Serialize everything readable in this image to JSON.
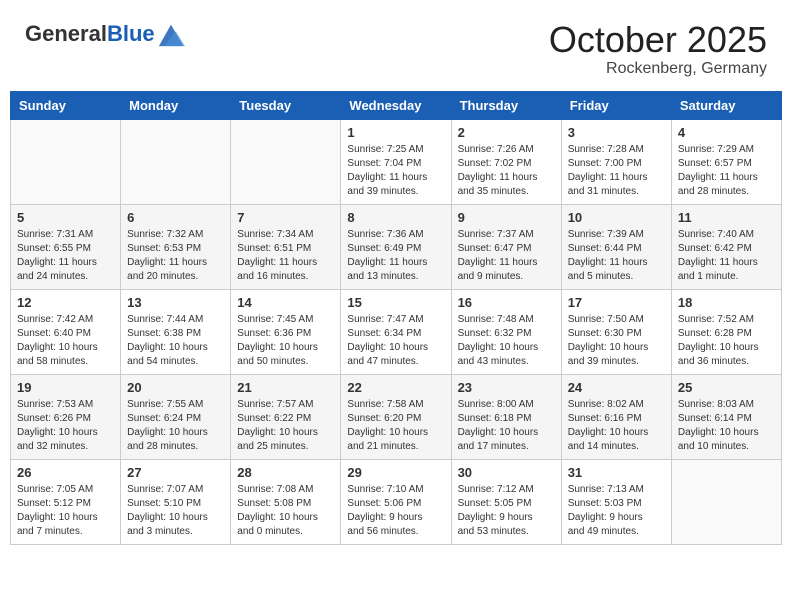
{
  "header": {
    "logo_general": "General",
    "logo_blue": "Blue",
    "month": "October 2025",
    "location": "Rockenberg, Germany"
  },
  "weekdays": [
    "Sunday",
    "Monday",
    "Tuesday",
    "Wednesday",
    "Thursday",
    "Friday",
    "Saturday"
  ],
  "weeks": [
    [
      {
        "day": "",
        "info": ""
      },
      {
        "day": "",
        "info": ""
      },
      {
        "day": "",
        "info": ""
      },
      {
        "day": "1",
        "info": "Sunrise: 7:25 AM\nSunset: 7:04 PM\nDaylight: 11 hours\nand 39 minutes."
      },
      {
        "day": "2",
        "info": "Sunrise: 7:26 AM\nSunset: 7:02 PM\nDaylight: 11 hours\nand 35 minutes."
      },
      {
        "day": "3",
        "info": "Sunrise: 7:28 AM\nSunset: 7:00 PM\nDaylight: 11 hours\nand 31 minutes."
      },
      {
        "day": "4",
        "info": "Sunrise: 7:29 AM\nSunset: 6:57 PM\nDaylight: 11 hours\nand 28 minutes."
      }
    ],
    [
      {
        "day": "5",
        "info": "Sunrise: 7:31 AM\nSunset: 6:55 PM\nDaylight: 11 hours\nand 24 minutes."
      },
      {
        "day": "6",
        "info": "Sunrise: 7:32 AM\nSunset: 6:53 PM\nDaylight: 11 hours\nand 20 minutes."
      },
      {
        "day": "7",
        "info": "Sunrise: 7:34 AM\nSunset: 6:51 PM\nDaylight: 11 hours\nand 16 minutes."
      },
      {
        "day": "8",
        "info": "Sunrise: 7:36 AM\nSunset: 6:49 PM\nDaylight: 11 hours\nand 13 minutes."
      },
      {
        "day": "9",
        "info": "Sunrise: 7:37 AM\nSunset: 6:47 PM\nDaylight: 11 hours\nand 9 minutes."
      },
      {
        "day": "10",
        "info": "Sunrise: 7:39 AM\nSunset: 6:44 PM\nDaylight: 11 hours\nand 5 minutes."
      },
      {
        "day": "11",
        "info": "Sunrise: 7:40 AM\nSunset: 6:42 PM\nDaylight: 11 hours\nand 1 minute."
      }
    ],
    [
      {
        "day": "12",
        "info": "Sunrise: 7:42 AM\nSunset: 6:40 PM\nDaylight: 10 hours\nand 58 minutes."
      },
      {
        "day": "13",
        "info": "Sunrise: 7:44 AM\nSunset: 6:38 PM\nDaylight: 10 hours\nand 54 minutes."
      },
      {
        "day": "14",
        "info": "Sunrise: 7:45 AM\nSunset: 6:36 PM\nDaylight: 10 hours\nand 50 minutes."
      },
      {
        "day": "15",
        "info": "Sunrise: 7:47 AM\nSunset: 6:34 PM\nDaylight: 10 hours\nand 47 minutes."
      },
      {
        "day": "16",
        "info": "Sunrise: 7:48 AM\nSunset: 6:32 PM\nDaylight: 10 hours\nand 43 minutes."
      },
      {
        "day": "17",
        "info": "Sunrise: 7:50 AM\nSunset: 6:30 PM\nDaylight: 10 hours\nand 39 minutes."
      },
      {
        "day": "18",
        "info": "Sunrise: 7:52 AM\nSunset: 6:28 PM\nDaylight: 10 hours\nand 36 minutes."
      }
    ],
    [
      {
        "day": "19",
        "info": "Sunrise: 7:53 AM\nSunset: 6:26 PM\nDaylight: 10 hours\nand 32 minutes."
      },
      {
        "day": "20",
        "info": "Sunrise: 7:55 AM\nSunset: 6:24 PM\nDaylight: 10 hours\nand 28 minutes."
      },
      {
        "day": "21",
        "info": "Sunrise: 7:57 AM\nSunset: 6:22 PM\nDaylight: 10 hours\nand 25 minutes."
      },
      {
        "day": "22",
        "info": "Sunrise: 7:58 AM\nSunset: 6:20 PM\nDaylight: 10 hours\nand 21 minutes."
      },
      {
        "day": "23",
        "info": "Sunrise: 8:00 AM\nSunset: 6:18 PM\nDaylight: 10 hours\nand 17 minutes."
      },
      {
        "day": "24",
        "info": "Sunrise: 8:02 AM\nSunset: 6:16 PM\nDaylight: 10 hours\nand 14 minutes."
      },
      {
        "day": "25",
        "info": "Sunrise: 8:03 AM\nSunset: 6:14 PM\nDaylight: 10 hours\nand 10 minutes."
      }
    ],
    [
      {
        "day": "26",
        "info": "Sunrise: 7:05 AM\nSunset: 5:12 PM\nDaylight: 10 hours\nand 7 minutes."
      },
      {
        "day": "27",
        "info": "Sunrise: 7:07 AM\nSunset: 5:10 PM\nDaylight: 10 hours\nand 3 minutes."
      },
      {
        "day": "28",
        "info": "Sunrise: 7:08 AM\nSunset: 5:08 PM\nDaylight: 10 hours\nand 0 minutes."
      },
      {
        "day": "29",
        "info": "Sunrise: 7:10 AM\nSunset: 5:06 PM\nDaylight: 9 hours\nand 56 minutes."
      },
      {
        "day": "30",
        "info": "Sunrise: 7:12 AM\nSunset: 5:05 PM\nDaylight: 9 hours\nand 53 minutes."
      },
      {
        "day": "31",
        "info": "Sunrise: 7:13 AM\nSunset: 5:03 PM\nDaylight: 9 hours\nand 49 minutes."
      },
      {
        "day": "",
        "info": ""
      }
    ]
  ]
}
